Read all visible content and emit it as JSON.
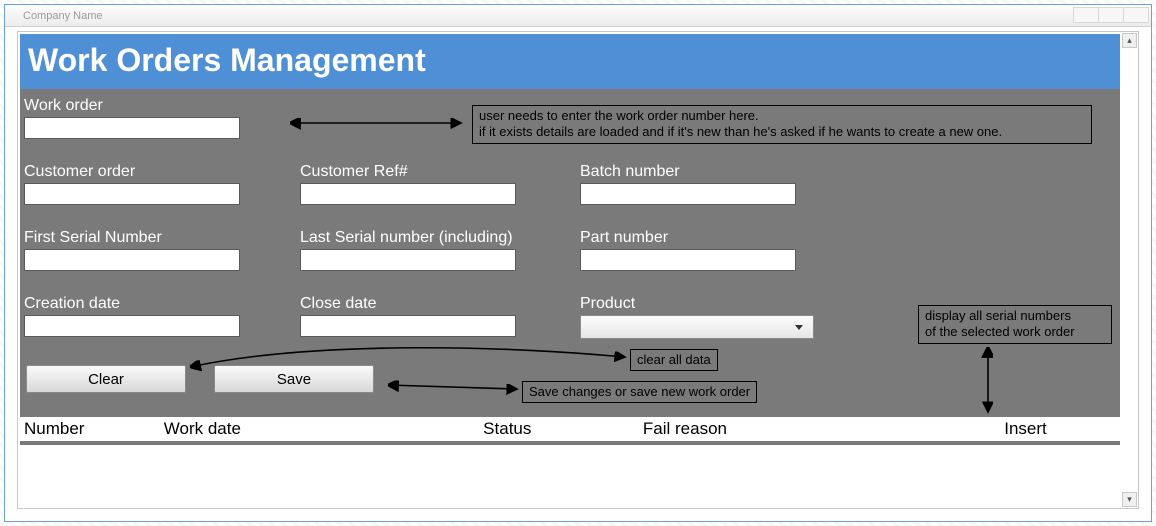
{
  "window": {
    "title": "Company Name"
  },
  "header": {
    "title": "Work Orders Management"
  },
  "form": {
    "work_order_label": "Work order",
    "work_order_value": "",
    "customer_order_label": "Customer order",
    "customer_order_value": "",
    "customer_ref_label": "Customer Ref#",
    "customer_ref_value": "",
    "batch_number_label": "Batch number",
    "batch_number_value": "",
    "first_serial_label": "First Serial Number",
    "first_serial_value": "",
    "last_serial_label": "Last Serial number (including)",
    "last_serial_value": "",
    "part_number_label": "Part number",
    "part_number_value": "",
    "creation_date_label": "Creation date",
    "creation_date_value": "",
    "close_date_label": "Close date",
    "close_date_value": "",
    "product_label": "Product",
    "product_selected": ""
  },
  "buttons": {
    "clear": "Clear",
    "save": "Save"
  },
  "annotations": {
    "work_order_hint": "user needs to enter the work order number here.\nif it exists details are loaded and if it's new than he's asked if he wants to create a new one.",
    "clear_hint": "clear all data",
    "save_hint": "Save changes or save new work order",
    "serial_display_hint": "display all serial numbers\nof the selected work order"
  },
  "table": {
    "columns": [
      "Number",
      "Work date",
      "Status",
      "Fail reason",
      "Insert"
    ]
  }
}
